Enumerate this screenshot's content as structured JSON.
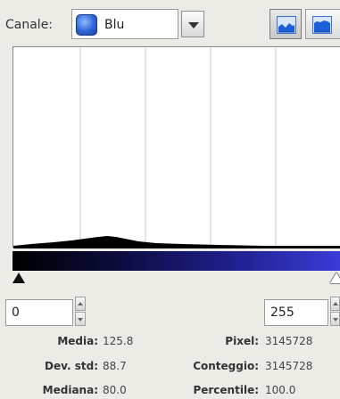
{
  "toolbar": {
    "channel_label": "Canale:",
    "channel_value": "Blu",
    "channel_icon": "blue-channel-icon",
    "linear_icon": "linear-histogram-icon",
    "log_icon": "logarithmic-histogram-icon"
  },
  "histogram": {
    "gridlines": 5,
    "line_color": "#000000",
    "gradient_colors": [
      "#000000",
      "#3b3bd8"
    ]
  },
  "range": {
    "low": "0",
    "high": "255"
  },
  "stats": {
    "mean_label": "Media:",
    "mean_value": "125.8",
    "stddev_label": "Dev. std:",
    "stddev_value": "88.7",
    "median_label": "Mediana:",
    "median_value": "80.0",
    "pixels_label": "Pixel:",
    "pixels_value": "3145728",
    "count_label": "Conteggio:",
    "count_value": "3145728",
    "percentile_label": "Percentile:",
    "percentile_value": "100.0"
  }
}
